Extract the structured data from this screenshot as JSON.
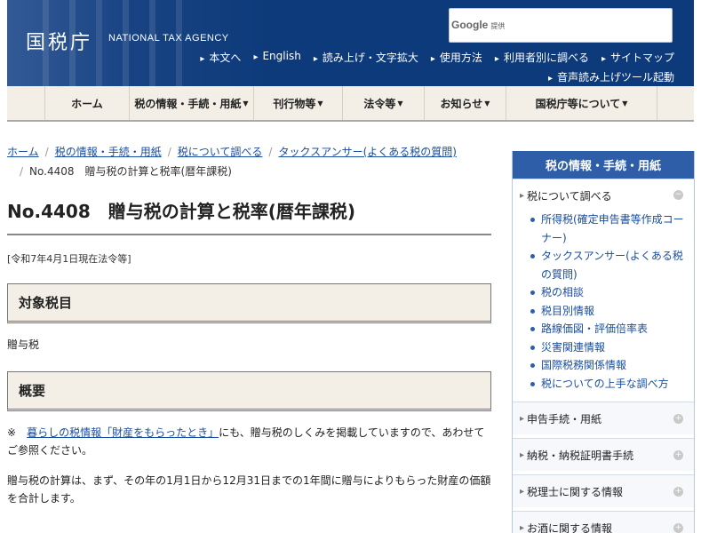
{
  "header": {
    "logo_jp": "国税庁",
    "logo_en": "NATIONAL TAX AGENCY",
    "search": {
      "brand": "Google",
      "brand_sub": "提供"
    },
    "util_links": [
      "本文へ",
      "English",
      "読み上げ・文字拡大",
      "使用方法",
      "利用者別に調べる",
      "サイトマップ"
    ],
    "util_links2": [
      "音声読み上げツール起動"
    ],
    "brand_color": "#0d3a7a"
  },
  "nav": {
    "items": [
      {
        "label": "ホーム",
        "has_dropdown": false
      },
      {
        "label": "税の情報・手続・用紙",
        "has_dropdown": true
      },
      {
        "label": "刊行物等",
        "has_dropdown": true
      },
      {
        "label": "法令等",
        "has_dropdown": true
      },
      {
        "label": "お知らせ",
        "has_dropdown": true
      },
      {
        "label": "国税庁等について",
        "has_dropdown": true
      }
    ]
  },
  "breadcrumb": {
    "links": [
      "ホーム",
      "税の情報・手続・用紙",
      "税について調べる",
      "タックスアンサー(よくある税の質問)"
    ],
    "current": "No.4408　贈与税の計算と税率(暦年課税)"
  },
  "main": {
    "title": "No.4408　贈与税の計算と税率(暦年課税)",
    "as_of": "[令和7年4月1日現在法令等]",
    "section1_heading": "対象税目",
    "section1_body": "贈与税",
    "section2_heading": "概要",
    "note_prefix": "※　",
    "note_link": "暮らしの税情報「財産をもらったとき」",
    "note_rest": "にも、贈与税のしくみを掲載していますので、あわせてご参照ください。",
    "para1": "贈与税の計算は、まず、その年の1月1日から12月31日までの1年間に贈与によりもらった財産の価額を合計します。"
  },
  "sidebar": {
    "heading": "税の情報・手続・用紙",
    "open_group": {
      "title": "税について調べる",
      "items": [
        "所得税(確定申告書等作成コーナー)",
        "タックスアンサー(よくある税の質問)",
        "税の相談",
        "税目別情報",
        "路線価図・評価倍率表",
        "災害関連情報",
        "国際税務関係情報",
        "税についての上手な調べ方"
      ]
    },
    "collapsed": [
      "申告手続・用紙",
      "納税・納税証明書手続",
      "税理士に関する情報",
      "お酒に関する情報"
    ],
    "accent_color": "#2f5ea8"
  }
}
